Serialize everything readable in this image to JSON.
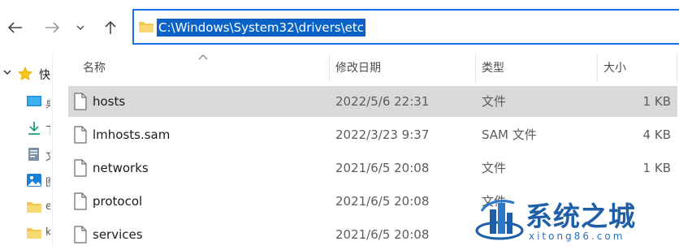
{
  "address": {
    "path": "C:\\Windows\\System32\\drivers\\etc"
  },
  "nav_pane": {
    "items": [
      {
        "icon": "star-icon",
        "label": "快",
        "expanded": true
      },
      {
        "icon": "desktop-icon",
        "label": "桌"
      },
      {
        "icon": "download-icon",
        "label": "下"
      },
      {
        "icon": "document-icon",
        "label": "文"
      },
      {
        "icon": "pictures-icon",
        "label": "图"
      },
      {
        "icon": "folder-icon",
        "label": "e"
      },
      {
        "icon": "folder-icon",
        "label": "k"
      }
    ]
  },
  "columns": {
    "name": "名称",
    "modified": "修改日期",
    "type": "类型",
    "size": "大小"
  },
  "files": [
    {
      "name": "hosts",
      "modified": "2022/5/6 22:31",
      "type": "文件",
      "size": "1 KB",
      "selected": true
    },
    {
      "name": "lmhosts.sam",
      "modified": "2022/3/23 9:37",
      "type": "SAM 文件",
      "size": "4 KB"
    },
    {
      "name": "networks",
      "modified": "2021/6/5 20:08",
      "type": "文件",
      "size": "1 KB"
    },
    {
      "name": "protocol",
      "modified": "2021/6/5 20:08",
      "type": "文件",
      "size": ""
    },
    {
      "name": "services",
      "modified": "2021/6/5 20:08",
      "type": "",
      "size": ""
    }
  ],
  "watermark": {
    "title": "系统之城",
    "url": "xitong86.com"
  },
  "colors": {
    "accent": "#0b63c8",
    "selection": "#d9d9d9",
    "folder": "#f4c84a",
    "brand": "#1f5fa8"
  }
}
